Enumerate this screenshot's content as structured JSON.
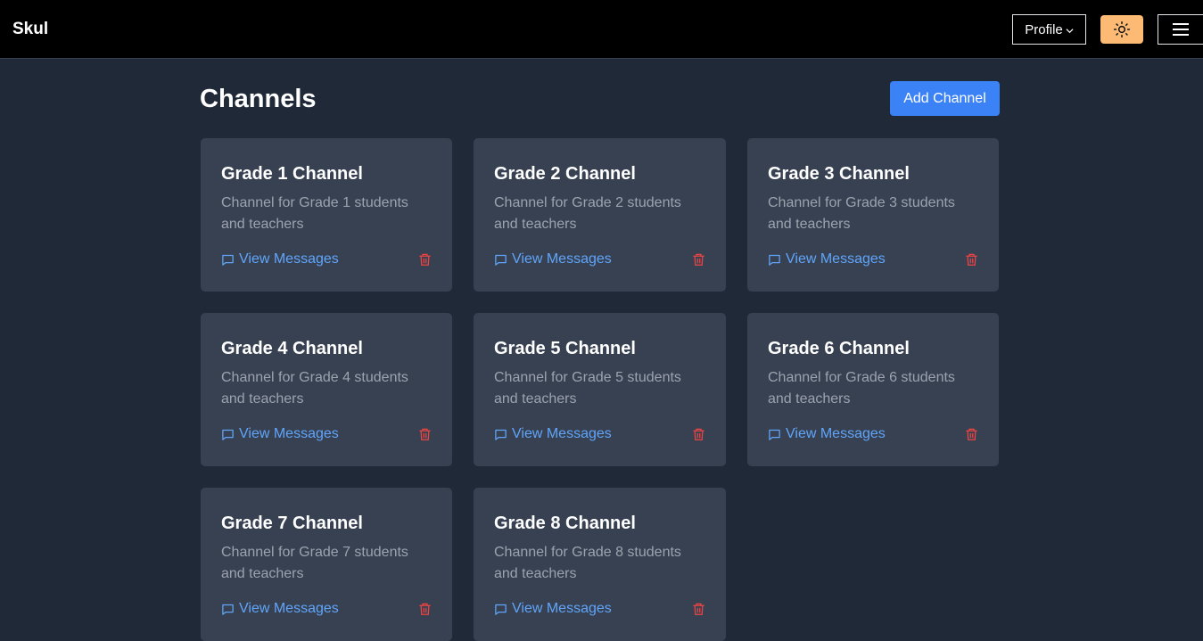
{
  "app": {
    "title": "Skul"
  },
  "header": {
    "profile_label": "Profile",
    "theme_toggle_icon": "sun-icon",
    "menu_icon": "hamburger-icon"
  },
  "page": {
    "title": "Channels",
    "add_button_label": "Add Channel"
  },
  "channels": [
    {
      "title": "Grade 1 Channel",
      "description": "Channel for Grade 1 students and teachers",
      "link_label": "View Messages"
    },
    {
      "title": "Grade 2 Channel",
      "description": "Channel for Grade 2 students and teachers",
      "link_label": "View Messages"
    },
    {
      "title": "Grade 3 Channel",
      "description": "Channel for Grade 3 students and teachers",
      "link_label": "View Messages"
    },
    {
      "title": "Grade 4 Channel",
      "description": "Channel for Grade 4 students and teachers",
      "link_label": "View Messages"
    },
    {
      "title": "Grade 5 Channel",
      "description": "Channel for Grade 5 students and teachers",
      "link_label": "View Messages"
    },
    {
      "title": "Grade 6 Channel",
      "description": "Channel for Grade 6 students and teachers",
      "link_label": "View Messages"
    },
    {
      "title": "Grade 7 Channel",
      "description": "Channel for Grade 7 students and teachers",
      "link_label": "View Messages"
    },
    {
      "title": "Grade 8 Channel",
      "description": "Channel for Grade 8 students and teachers",
      "link_label": "View Messages"
    }
  ],
  "colors": {
    "background": "#1f2937",
    "card": "#374151",
    "accent": "#3b82f6",
    "link": "#60a5fa",
    "danger": "#ef4444",
    "theme_button": "#fdba74"
  }
}
